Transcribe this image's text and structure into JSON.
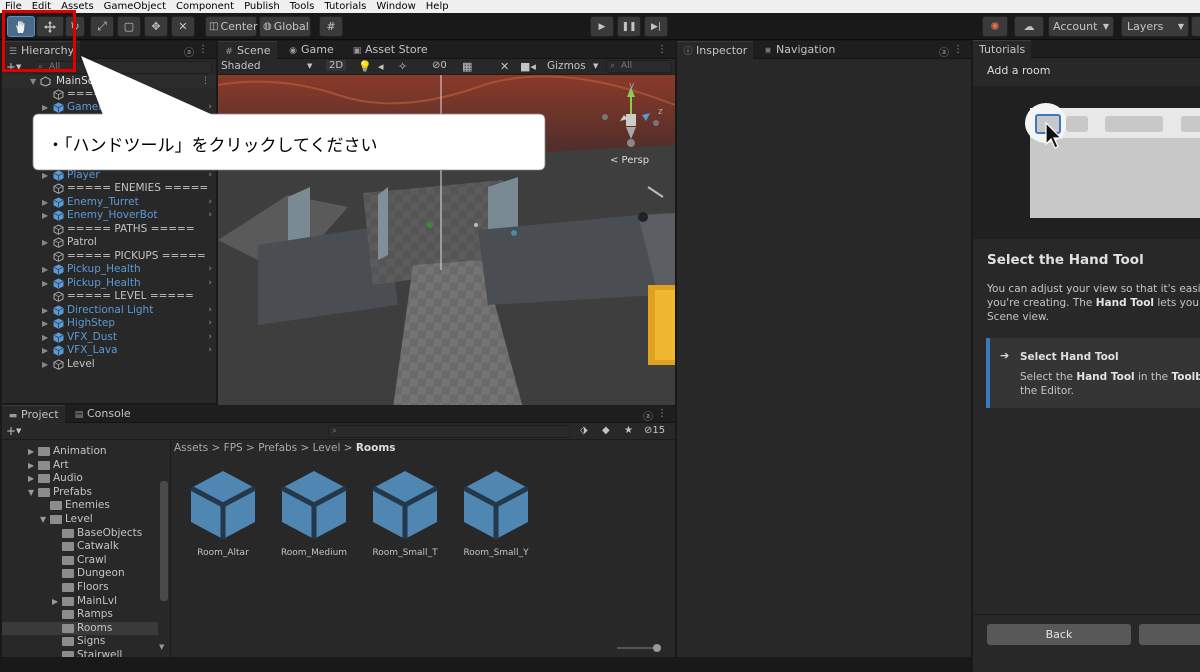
{
  "menu": [
    "File",
    "Edit",
    "Assets",
    "GameObject",
    "Component",
    "Publish",
    "Tools",
    "Tutorials",
    "Window",
    "Help"
  ],
  "toolbar": {
    "pivot_label": "Center",
    "space_label": "Global",
    "account_label": "Account",
    "layers_label": "Layers"
  },
  "hierarchy": {
    "tab_label": "Hierarchy",
    "search_placeholder": "All",
    "scene_name": "MainScene",
    "items": [
      {
        "label": "===== G",
        "color": "gray",
        "prefab": false
      },
      {
        "label": "GameMan",
        "color": "blue",
        "prefab": true
      },
      {
        "label": "Player",
        "color": "blue",
        "prefab": true
      },
      {
        "label": "===== ENEMIES =====",
        "color": "gray",
        "prefab": false
      },
      {
        "label": "Enemy_Turret",
        "color": "blue",
        "prefab": true
      },
      {
        "label": "Enemy_HoverBot",
        "color": "blue",
        "prefab": true
      },
      {
        "label": "===== PATHS =====",
        "color": "gray",
        "prefab": false
      },
      {
        "label": "Patrol",
        "color": "gray",
        "prefab": false
      },
      {
        "label": "===== PICKUPS =====",
        "color": "gray",
        "prefab": false
      },
      {
        "label": "Pickup_Health",
        "color": "blue",
        "prefab": true
      },
      {
        "label": "Pickup_Health",
        "color": "blue",
        "prefab": true
      },
      {
        "label": "===== LEVEL =====",
        "color": "gray",
        "prefab": false
      },
      {
        "label": "Directional Light",
        "color": "blue",
        "prefab": true
      },
      {
        "label": "HighStep",
        "color": "blue",
        "prefab": true
      },
      {
        "label": "VFX_Dust",
        "color": "blue",
        "prefab": true
      },
      {
        "label": "VFX_Lava",
        "color": "blue",
        "prefab": true
      },
      {
        "label": "Level",
        "color": "gray",
        "prefab": false
      }
    ]
  },
  "scene": {
    "tabs": [
      "Scene",
      "Game",
      "Asset Store"
    ],
    "shading": "Shaded",
    "mode_2d": "2D",
    "hidden_count": "0",
    "gizmos": "Gizmos",
    "search_placeholder": "All",
    "persp_label": "< Persp",
    "axis_y": "y",
    "axis_z": "z"
  },
  "inspector": {
    "tabs": [
      "Inspector",
      "Navigation"
    ]
  },
  "project": {
    "tabs": [
      "Project",
      "Console"
    ],
    "badge": "15",
    "breadcrumb": [
      "Assets",
      "FPS",
      "Prefabs",
      "Level",
      "Rooms"
    ],
    "tree": [
      {
        "label": "Animation",
        "depth": 1,
        "arrow": "▶"
      },
      {
        "label": "Art",
        "depth": 1,
        "arrow": "▶"
      },
      {
        "label": "Audio",
        "depth": 1,
        "arrow": "▶"
      },
      {
        "label": "Prefabs",
        "depth": 1,
        "arrow": "▼"
      },
      {
        "label": "Enemies",
        "depth": 2,
        "arrow": ""
      },
      {
        "label": "Level",
        "depth": 2,
        "arrow": "▼"
      },
      {
        "label": "BaseObjects",
        "depth": 3,
        "arrow": ""
      },
      {
        "label": "Catwalk",
        "depth": 3,
        "arrow": ""
      },
      {
        "label": "Crawl",
        "depth": 3,
        "arrow": ""
      },
      {
        "label": "Dungeon",
        "depth": 3,
        "arrow": ""
      },
      {
        "label": "Floors",
        "depth": 3,
        "arrow": ""
      },
      {
        "label": "MainLvl",
        "depth": 3,
        "arrow": "▶"
      },
      {
        "label": "Ramps",
        "depth": 3,
        "arrow": ""
      },
      {
        "label": "Rooms",
        "depth": 3,
        "arrow": ""
      },
      {
        "label": "Signs",
        "depth": 3,
        "arrow": ""
      },
      {
        "label": "Stairwell",
        "depth": 3,
        "arrow": ""
      }
    ],
    "assets": [
      "Room_Altar",
      "Room_Medium",
      "Room_Small_T",
      "Room_Small_Y"
    ]
  },
  "tutorial": {
    "tab_label": "Tutorials",
    "header": "Add a room",
    "title": "Select the Hand Tool",
    "desc_1": "You can adjust your view so that it's easier",
    "desc_2_a": "you're creating. The ",
    "desc_2_b": "Hand Tool",
    "desc_2_c": " lets you nav",
    "desc_3": "Scene view.",
    "task_title": "Select Hand Tool",
    "task_1_a": "Select the ",
    "task_1_b": "Hand Tool",
    "task_1_c": " in the ",
    "task_1_d": "Toolbar",
    "task_2": "the Editor.",
    "back_label": "Back"
  },
  "annotation": {
    "callout_text": "・「ハンドツール」をクリックしてください"
  },
  "colors": {
    "highlight": "#e00000",
    "accent": "#3a79bb",
    "prefab": "#5b9ad6"
  }
}
